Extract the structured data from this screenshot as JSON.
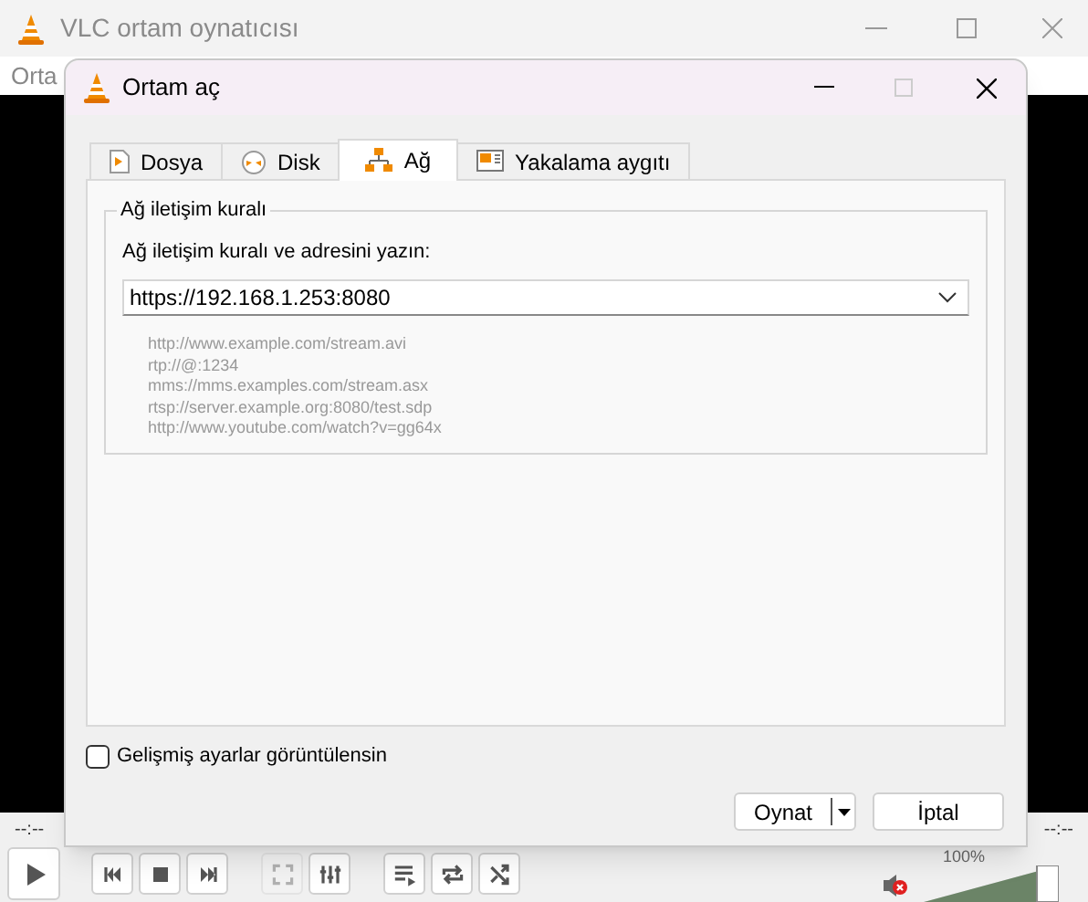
{
  "main_window": {
    "title": "VLC ortam oynatıcısı",
    "menu": [
      "Orta"
    ],
    "time_elapsed": "--:--",
    "time_total": "--:--",
    "controls": [
      {
        "kind": "play",
        "disabled": false
      },
      {
        "kind": "previous",
        "disabled": false
      },
      {
        "kind": "stop",
        "disabled": false
      },
      {
        "kind": "next",
        "disabled": false
      },
      {
        "kind": "fullscreen",
        "disabled": true
      },
      {
        "kind": "equalizer",
        "disabled": false
      },
      {
        "kind": "playlist",
        "disabled": false
      },
      {
        "kind": "loop",
        "disabled": false
      },
      {
        "kind": "shuffle",
        "disabled": false
      }
    ],
    "volume": {
      "muted": true,
      "level": 1.0,
      "reading": "100%"
    }
  },
  "dialog": {
    "title": "Ortam aç",
    "tabs": [
      {
        "label": "Dosya",
        "kind": "file",
        "selected": false
      },
      {
        "label": "Disk",
        "kind": "disc",
        "selected": false
      },
      {
        "label": "Ağ",
        "kind": "network",
        "selected": true
      },
      {
        "label": "Yakalama aygıtı",
        "kind": "capture",
        "selected": false
      }
    ],
    "group_title": "Ağ iletişim kuralı",
    "url_label": "Ağ iletişim kuralı ve adresini yazın:",
    "url_value": "https://192.168.1.253:8080",
    "examples": [
      "http://www.example.com/stream.avi",
      "rtp://@:1234",
      "mms://mms.examples.com/stream.asx",
      "rtsp://server.example.org:8080/test.sdp",
      "http://www.youtube.com/watch?v=gg64x"
    ],
    "advanced_checkbox": {
      "label": "Gelişmiş ayarlar görüntülensin",
      "checked": false
    },
    "buttons": [
      {
        "label": "Oynat",
        "kind": "split"
      },
      {
        "label": "İptal",
        "kind": "plain"
      }
    ]
  }
}
